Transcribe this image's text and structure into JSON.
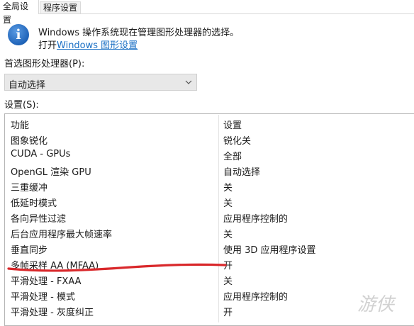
{
  "tabs": [
    {
      "label": "全局设置"
    },
    {
      "label": "程序设置"
    }
  ],
  "info": {
    "line1": "Windows 操作系统现在管理图形处理器的选择。",
    "line2_prefix": "打开",
    "link_text": "Windows 图形设置"
  },
  "preferred_gpu": {
    "label": "首选图形处理器(P):",
    "selected": "自动选择"
  },
  "settings_label": "设置(S):",
  "table": {
    "headers": [
      "功能",
      "设置"
    ],
    "rows": [
      {
        "feature": "图象锐化",
        "value": "锐化关"
      },
      {
        "feature": "CUDA - GPUs",
        "value": "全部"
      },
      {
        "feature": "OpenGL 渲染 GPU",
        "value": "自动选择"
      },
      {
        "feature": "三重缓冲",
        "value": "关"
      },
      {
        "feature": "低延时模式",
        "value": "关"
      },
      {
        "feature": "各向异性过滤",
        "value": "应用程序控制的"
      },
      {
        "feature": "后台应用程序最大帧速率",
        "value": "关"
      },
      {
        "feature": "垂直同步",
        "value": "使用 3D 应用程序设置"
      },
      {
        "feature": "多帧采样 AA (MFAA)",
        "value": "开"
      },
      {
        "feature": "平滑处理 - FXAA",
        "value": "关"
      },
      {
        "feature": "平滑处理 - 模式",
        "value": "应用程序控制的"
      },
      {
        "feature": "平滑处理 - 灰度纠正",
        "value": "开"
      }
    ]
  },
  "annotation_color": "#d9282b",
  "watermark": {
    "text": "游侠网"
  }
}
